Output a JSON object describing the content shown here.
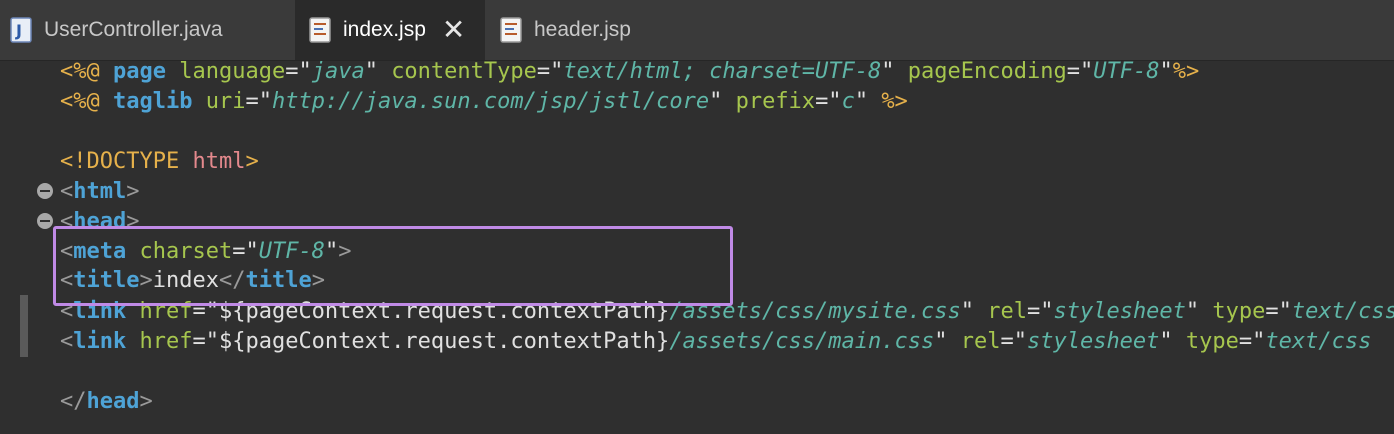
{
  "tabs": [
    {
      "label": "UserController.java",
      "icon": "java-file-icon",
      "active": false
    },
    {
      "label": "index.jsp",
      "icon": "jsp-file-icon",
      "active": true,
      "close": "✕"
    },
    {
      "label": "header.jsp",
      "icon": "jsp-file-icon",
      "active": false
    }
  ],
  "code": {
    "l1": {
      "open": "<%@",
      "kw": "page",
      "a1": "language",
      "v1": "java",
      "a2": "contentType",
      "v2": "text/html; charset=UTF-8",
      "a3": "pageEncoding",
      "v3": "UTF-8",
      "close": "%>"
    },
    "l2": {
      "open": "<%@",
      "kw": "taglib",
      "a1": "uri",
      "v1": "http://java.sun.com/jsp/jstl/core",
      "a2": "prefix",
      "v2": "c",
      "close": "%>"
    },
    "l4": {
      "open": "<!DOCTYPE",
      "val": "html",
      "close": ">"
    },
    "l5": {
      "lt": "<",
      "tag": "html",
      "gt": ">"
    },
    "l6": {
      "lt": "<",
      "tag": "head",
      "gt": ">"
    },
    "l7": {
      "lt": "<",
      "tag": "meta",
      "a1": "charset",
      "v1": "UTF-8",
      "gt": ">"
    },
    "l8": {
      "lt": "<",
      "tag": "title",
      "gt": ">",
      "text": "index",
      "lt2": "</",
      "tag2": "title",
      "gt2": ">"
    },
    "l9": {
      "lt": "<",
      "tag": "link",
      "a1": "href",
      "expr": "${pageContext.request.contextPath}",
      "path": "/assets/css/mysite.css",
      "a2": "rel",
      "v2": "stylesheet",
      "a3": "type",
      "v3": "text/css"
    },
    "l10": {
      "lt": "<",
      "tag": "link",
      "a1": "href",
      "expr": "${pageContext.request.contextPath}",
      "path": "/assets/css/main.css",
      "a2": "rel",
      "v2": "stylesheet",
      "a3": "type",
      "v3": "text/css"
    },
    "l12": {
      "lt": "</",
      "tag": "head",
      "gt": ">"
    }
  }
}
